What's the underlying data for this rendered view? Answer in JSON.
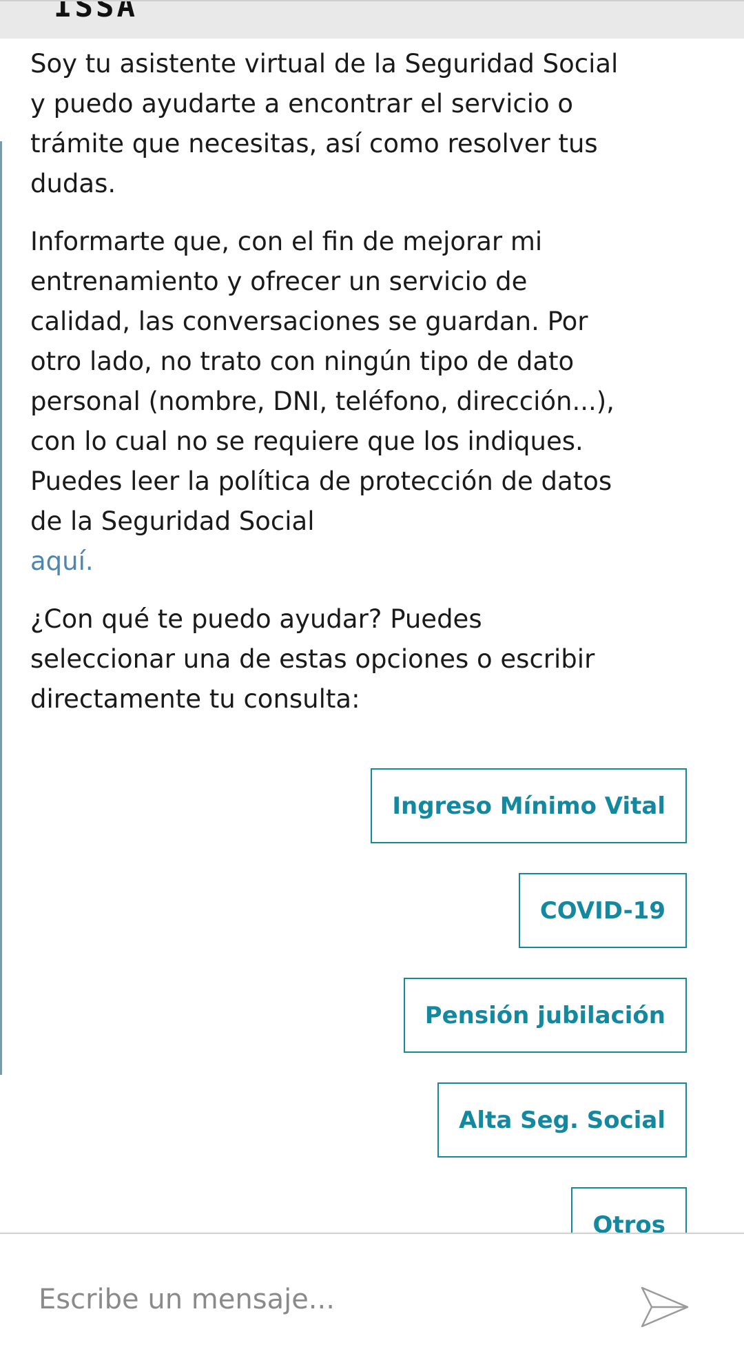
{
  "header": {
    "logo_text": "ISSA"
  },
  "message": {
    "paragraph_1": "Soy tu asistente virtual de la Seguridad Social y puedo ayudarte a encontrar el servicio o trámite que necesitas, así como resolver tus dudas.",
    "paragraph_2": "Informarte que, con el fin de mejorar mi entrenamiento y ofrecer un servicio de calidad, las conversaciones se guardan. Por otro lado, no trato con ningún tipo de dato personal (nombre, DNI, teléfono, dirección...), con lo cual no se requiere que los indiques. Puedes leer la política de protección de datos de la Seguridad Social",
    "link_text": "aquí.",
    "paragraph_3": "¿Con qué te puedo ayudar? Puedes seleccionar una de estas opciones o escribir directamente tu consulta:"
  },
  "options": [
    {
      "label": "Ingreso Mínimo Vital"
    },
    {
      "label": "COVID-19"
    },
    {
      "label": "Pensión jubilación"
    },
    {
      "label": "Alta Seg. Social"
    },
    {
      "label": "Otros"
    }
  ],
  "composer": {
    "placeholder": "Escribe un mensaje...",
    "send_icon": "send-icon"
  },
  "colors": {
    "accent": "#14889e",
    "link": "#4f86ad",
    "header_bg": "#e9e9e9"
  }
}
